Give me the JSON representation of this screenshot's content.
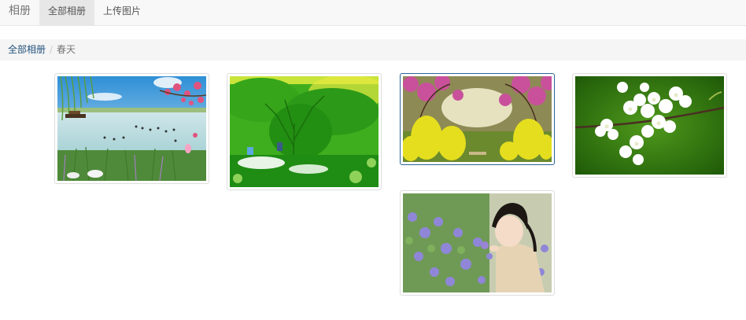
{
  "navbar": {
    "brand": "相册",
    "items": [
      {
        "label": "全部相册",
        "active": true
      },
      {
        "label": "上传图片",
        "active": false
      }
    ]
  },
  "breadcrumb": {
    "root": "全部相册",
    "separator": "/",
    "current": "春天"
  },
  "photos": [
    {
      "subject": "willow lake with boat, swans and peach blossoms"
    },
    {
      "subject": "green willow tree by a pond with people"
    },
    {
      "subject": "yellow rapeseed flowers under pink blossom trees"
    },
    {
      "subject": "white plum blossoms on a branch"
    },
    {
      "subject": "girl smelling purple flowers"
    }
  ],
  "colors": {
    "link": "#23527c",
    "navbar_bg": "#f8f8f8",
    "active_nav_bg": "#e7e7e7",
    "breadcrumb_bg": "#f5f5f5"
  }
}
